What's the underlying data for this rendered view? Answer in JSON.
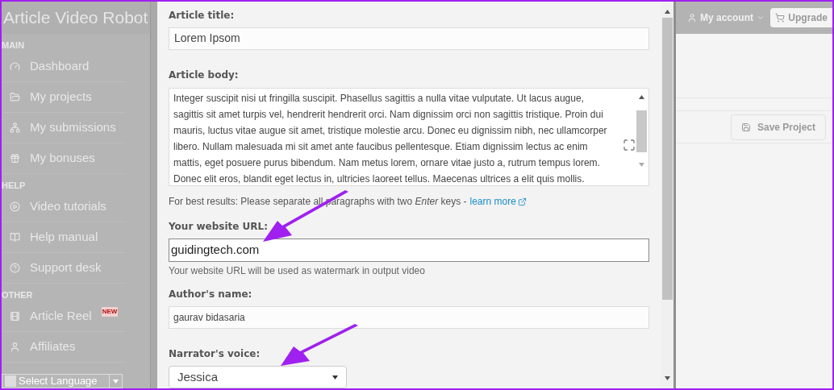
{
  "app": {
    "title": "Article Video Robot"
  },
  "sidebar": {
    "sections": [
      {
        "heading": "MAIN",
        "items": [
          {
            "label": "Dashboard"
          },
          {
            "label": "My projects"
          },
          {
            "label": "My submissions"
          },
          {
            "label": "My bonuses"
          }
        ]
      },
      {
        "heading": "HELP",
        "items": [
          {
            "label": "Video tutorials"
          },
          {
            "label": "Help manual"
          },
          {
            "label": "Support desk"
          }
        ]
      },
      {
        "heading": "OTHER",
        "items": [
          {
            "label": "Article Reel",
            "badge": "NEW"
          },
          {
            "label": "Affiliates"
          }
        ]
      }
    ]
  },
  "language_selector": {
    "label": "Select Language"
  },
  "top_bar": {
    "account": "My account",
    "upgrade": "Upgrade"
  },
  "toolbar": {
    "save": "Save Project"
  },
  "form": {
    "title_label": "Article title:",
    "title_value": "Lorem Ipsom",
    "body_label": "Article body:",
    "body_lines": [
      "Integer suscipit nisi ut fringilla suscipit. Phasellus sagittis a nulla vitae vulputate. Ut lacus augue,",
      "sagittis sit amet turpis vel, hendrerit hendrerit orci. Nam dignissim orci non sagittis tristique. Proin dui",
      "mauris, luctus vitae augue sit amet, tristique molestie arcu. Donec eu dignissim nibh, nec ullamcorper",
      "libero. Nullam malesuada mi sit amet ante faucibus pellentesque. Etiam dignissim lectus ac enim",
      "mattis, eget posuere purus bibendum. Nam metus lorem, ornare vitae justo a, rutrum tempus lorem.",
      "Donec elit eros, blandit eget lectus in, ultricies laoreet tellus. Maecenas ultrices a elit quis mollis."
    ],
    "body_hint": "For best results: Please separate all paragraphs with two *Enter* keys - ",
    "body_hint_link": "learn more",
    "url_label": "Your website URL:",
    "url_value": "guidingtech.com",
    "url_help": "Your website URL will be used as watermark in output video",
    "author_label": "Author's name:",
    "author_value": "gaurav bidasaria",
    "voice_label": "Narrator's voice:",
    "voice_value": "Jessica"
  }
}
